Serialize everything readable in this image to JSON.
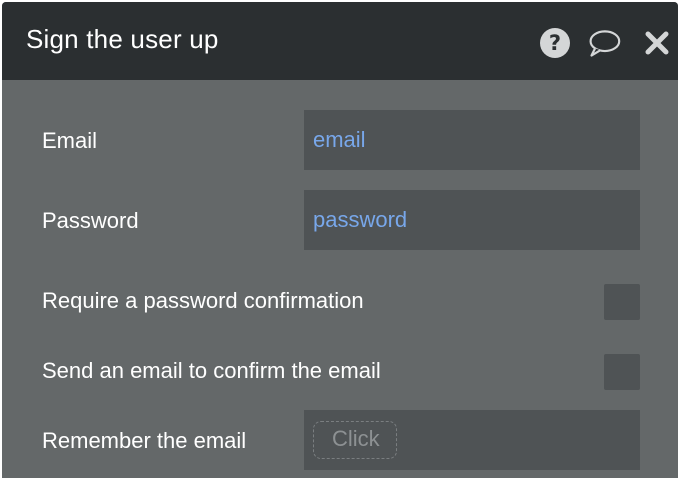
{
  "dialog": {
    "title": "Sign the user up"
  },
  "header_icons": [
    {
      "name": "help-icon"
    },
    {
      "name": "comment-icon"
    },
    {
      "name": "close-icon"
    }
  ],
  "fields": {
    "email": {
      "label": "Email",
      "value": "email"
    },
    "password": {
      "label": "Password",
      "value": "password"
    },
    "require_confirmation": {
      "label": "Require a password confirmation",
      "checked": false
    },
    "send_confirm_email": {
      "label": "Send an email to confirm the email",
      "checked": false
    },
    "remember_email": {
      "label": "Remember the email",
      "value": "Click"
    }
  },
  "colors": {
    "header_bg": "#2b2f31",
    "panel_bg": "#646869",
    "field_bg": "#4f5355",
    "dynamic_value": "#78a7ea"
  }
}
